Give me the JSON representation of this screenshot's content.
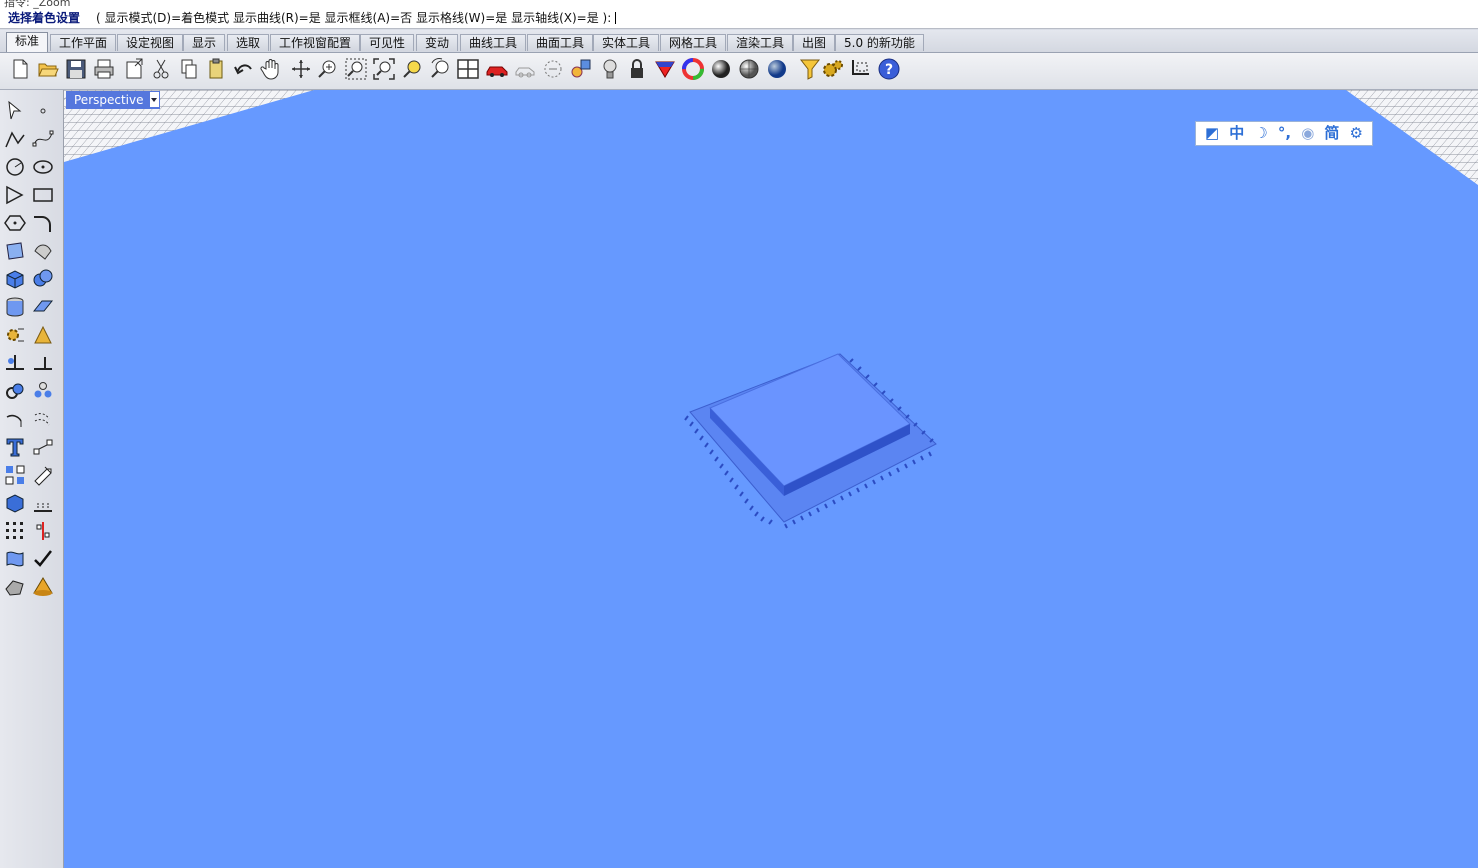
{
  "command": {
    "history_text": "指令: _Zoom",
    "prompt": "选择着色设置",
    "options": "( 显示模式(D)=着色模式  显示曲线(R)=是  显示框线(A)=否  显示格线(W)=是  显示轴线(X)=是 ):"
  },
  "tabs": [
    {
      "label": "标准",
      "active": true
    },
    {
      "label": "工作平面"
    },
    {
      "label": "设定视图"
    },
    {
      "label": "显示"
    },
    {
      "label": "选取"
    },
    {
      "label": "工作视窗配置"
    },
    {
      "label": "可见性"
    },
    {
      "label": "变动"
    },
    {
      "label": "曲线工具"
    },
    {
      "label": "曲面工具"
    },
    {
      "label": "实体工具"
    },
    {
      "label": "网格工具"
    },
    {
      "label": "渲染工具"
    },
    {
      "label": "出图"
    },
    {
      "label": "5.0 的新功能"
    }
  ],
  "toolbar_icons": [
    "new-file",
    "open-folder",
    "save",
    "print",
    "import",
    "cut",
    "copy",
    "paste",
    "undo",
    "pan-hand",
    "rotate-view",
    "zoom-in",
    "zoom-window",
    "zoom-extents",
    "zoom-selected",
    "undo-view",
    "four-viewports",
    "car-render",
    "ghosted",
    "circle-dashed",
    "shapes",
    "light-bulb",
    "lock",
    "layer-color",
    "color-wheel",
    "shade-sphere",
    "rendered-sphere",
    "blue-sphere",
    "filter-funnel",
    "settings-gears",
    "snap-box",
    "help"
  ],
  "left_tool_icons": [
    "select-arrow",
    "point",
    "polyline",
    "curve-control-points",
    "circle",
    "ellipse",
    "polygon-tri",
    "rectangle",
    "polygon-hex",
    "fillet-curve",
    "surface-points",
    "surface-edge",
    "box-solid",
    "boolean-spheres",
    "cylinder-solid",
    "extrude-surface",
    "transform-gear",
    "explode",
    "trim",
    "split",
    "join-circles",
    "group",
    "arc-curve",
    "offset-curve",
    "text-tool",
    "dimension",
    "grid-array",
    "scale",
    "box-blue",
    "ortho-snap",
    "points-array",
    "mirror",
    "loft",
    "check",
    "solid-tools",
    "cone"
  ],
  "viewport": {
    "name": "Perspective",
    "background": "#6699ff"
  },
  "ime_bar": {
    "items": [
      "◩",
      "中",
      "☽",
      "°,",
      "◉",
      "简",
      "⚙"
    ]
  }
}
